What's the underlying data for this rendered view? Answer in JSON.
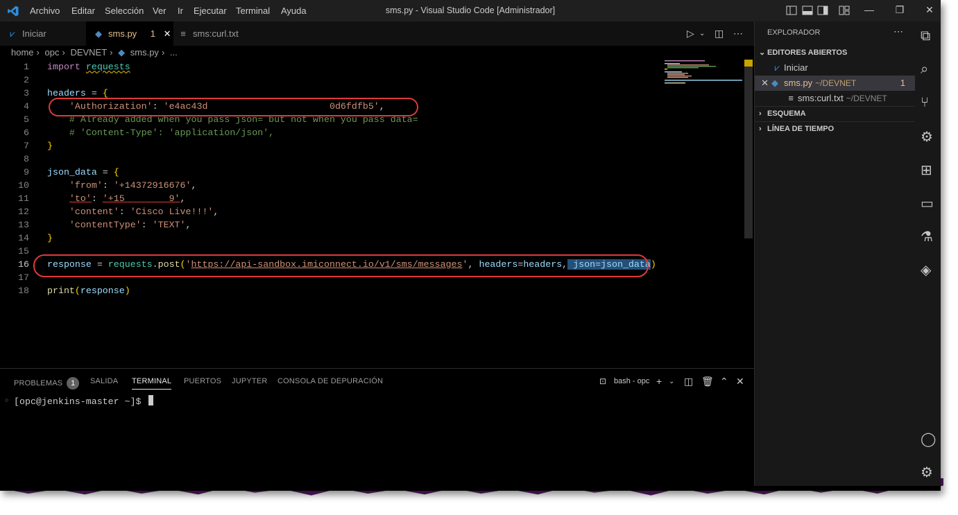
{
  "titlebar": {
    "menu": [
      "Archivo",
      "Editar",
      "Selección",
      "Ver",
      "Ir",
      "Ejecutar",
      "Terminal",
      "Ayuda"
    ],
    "title": "sms.py - Visual Studio Code [Administrador]",
    "controls": {
      "minimize": "—",
      "restore": "❐",
      "close": "✕"
    }
  },
  "tabs": {
    "welcome": "Iniciar",
    "active": "sms.py",
    "active_problems": "1",
    "other": "sms:curl.txt"
  },
  "breadcrumb": {
    "home": "home",
    "opc": "opc",
    "devnet": "DEVNET",
    "file": "sms.py",
    "more": "..."
  },
  "editor": {
    "line_numbers": [
      "1",
      "2",
      "3",
      "4",
      "5",
      "6",
      "7",
      "8",
      "9",
      "10",
      "11",
      "12",
      "13",
      "14",
      "15",
      "16",
      "17",
      "18"
    ],
    "l1_kw": "import",
    "l1_mod": "requests",
    "l3_var": "headers",
    "l3_eq": " = ",
    "l3_br": "{",
    "l4_key": "'Authorization'",
    "l4_sep": ": ",
    "l4_val": "'e4ac43d                      0d6fdfb5'",
    "l4_end": ",",
    "l5": "# Already added when you pass json= but not when you pass data=",
    "l6": "# 'Content-Type': 'application/json',",
    "l7": "}",
    "l9_var": "json_data",
    "l9_eq": " = ",
    "l9_br": "{",
    "l10_key": "'from'",
    "l10_sep": ": ",
    "l10_val": "'+14372916676'",
    "l10_end": ",",
    "l11_key": "'to'",
    "l11_sep": ": ",
    "l11_val": "'+15        9'",
    "l11_end": ",",
    "l12_key": "'content'",
    "l12_sep": ": ",
    "l12_val": "'Cisco Live!!!'",
    "l12_end": ",",
    "l13_key": "'contentType'",
    "l13_sep": ": ",
    "l13_val": "'TEXT'",
    "l13_end": ",",
    "l14": "}",
    "l16_var": "response",
    "l16_eq": " = ",
    "l16_mod": "requests",
    "l16_dot": ".",
    "l16_fn": "post",
    "l16_open": "(",
    "l16_q1": "'",
    "l16_url": "https://api-sandbox.imiconnect.io/v1/sms/messages",
    "l16_q2": "'",
    "l16_c1": ", ",
    "l16_h": "headers",
    "l16_eq2": "=",
    "l16_hv": "headers",
    "l16_c2": ",",
    "l16_sel": " json=json_data",
    "l16_close": ")",
    "l18_fn": "print",
    "l18_open": "(",
    "l18_arg": "response",
    "l18_close": ")"
  },
  "panel": {
    "tabs": [
      "PROBLEMAS",
      "SALIDA",
      "TERMINAL",
      "PUERTOS",
      "JUPYTER",
      "CONSOLA DE DEPURACIÓN"
    ],
    "problems_count": "1",
    "shell": "bash - opc",
    "prompt": "[opc@jenkins-master ~]$"
  },
  "sidebar": {
    "title": "EXPLORADOR",
    "open_editors": "EDITORES ABIERTOS",
    "files": [
      {
        "name": "Iniciar",
        "path": ""
      },
      {
        "name": "sms.py",
        "path": "~/DEVNET",
        "badge": "1"
      },
      {
        "name": "sms:curl.txt",
        "path": "~/DEVNET"
      }
    ],
    "outline": "ESQUEMA",
    "timeline": "LÍNEA DE TIEMPO"
  },
  "colors": {
    "accent": "#007acc",
    "modified": "#e2c08d",
    "highlight": "#e03a3a"
  }
}
